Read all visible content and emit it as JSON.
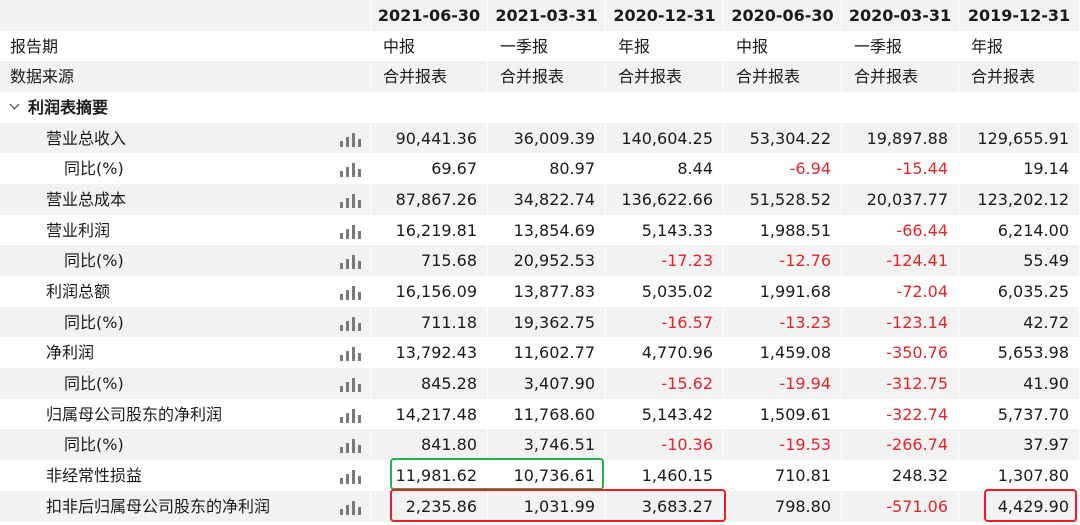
{
  "columns": [
    {
      "date": "2021-06-30",
      "type": "中报",
      "source": "合并报表"
    },
    {
      "date": "2021-03-31",
      "type": "一季报",
      "source": "合并报表"
    },
    {
      "date": "2020-12-31",
      "type": "年报",
      "source": "合并报表"
    },
    {
      "date": "2020-06-30",
      "type": "中报",
      "source": "合并报表"
    },
    {
      "date": "2020-03-31",
      "type": "一季报",
      "source": "合并报表"
    },
    {
      "date": "2019-12-31",
      "type": "年报",
      "source": "合并报表"
    }
  ],
  "labels": {
    "report_period": "报告期",
    "data_source": "数据来源",
    "section_title": "利润表摘要"
  },
  "rows": [
    {
      "label": "营业总收入",
      "indent": 1,
      "values": [
        "90,441.36",
        "36,009.39",
        "140,604.25",
        "53,304.22",
        "19,897.88",
        "129,655.91"
      ]
    },
    {
      "label": "同比(%)",
      "indent": 2,
      "values": [
        "69.67",
        "80.97",
        "8.44",
        "-6.94",
        "-15.44",
        "19.14"
      ]
    },
    {
      "label": "营业总成本",
      "indent": 1,
      "values": [
        "87,867.26",
        "34,822.74",
        "136,622.66",
        "51,528.52",
        "20,037.77",
        "123,202.12"
      ]
    },
    {
      "label": "营业利润",
      "indent": 1,
      "values": [
        "16,219.81",
        "13,854.69",
        "5,143.33",
        "1,988.51",
        "-66.44",
        "6,214.00"
      ]
    },
    {
      "label": "同比(%)",
      "indent": 2,
      "values": [
        "715.68",
        "20,952.53",
        "-17.23",
        "-12.76",
        "-124.41",
        "55.49"
      ]
    },
    {
      "label": "利润总额",
      "indent": 1,
      "values": [
        "16,156.09",
        "13,877.83",
        "5,035.02",
        "1,991.68",
        "-72.04",
        "6,035.25"
      ]
    },
    {
      "label": "同比(%)",
      "indent": 2,
      "values": [
        "711.18",
        "19,362.75",
        "-16.57",
        "-13.23",
        "-123.14",
        "42.72"
      ]
    },
    {
      "label": "净利润",
      "indent": 1,
      "values": [
        "13,792.43",
        "11,602.77",
        "4,770.96",
        "1,459.08",
        "-350.76",
        "5,653.98"
      ]
    },
    {
      "label": "同比(%)",
      "indent": 2,
      "values": [
        "845.28",
        "3,407.90",
        "-15.62",
        "-19.94",
        "-312.75",
        "41.90"
      ]
    },
    {
      "label": "归属母公司股东的净利润",
      "indent": 1,
      "values": [
        "14,217.48",
        "11,768.60",
        "5,143.42",
        "1,509.61",
        "-322.74",
        "5,737.70"
      ]
    },
    {
      "label": "同比(%)",
      "indent": 2,
      "values": [
        "841.80",
        "3,746.51",
        "-10.36",
        "-19.53",
        "-266.74",
        "37.97"
      ]
    },
    {
      "label": "非经常性损益",
      "indent": 1,
      "values": [
        "11,981.62",
        "10,736.61",
        "1,460.15",
        "710.81",
        "248.32",
        "1,307.80"
      ]
    },
    {
      "label": "扣非后归属母公司股东的净利润",
      "indent": 1,
      "values": [
        "2,235.86",
        "1,031.99",
        "3,683.27",
        "798.80",
        "-571.06",
        "4,429.90"
      ]
    }
  ],
  "colors": {
    "negative": "#e0262b",
    "highlight_green": "#22b14c",
    "highlight_red": "#ee1c24"
  }
}
